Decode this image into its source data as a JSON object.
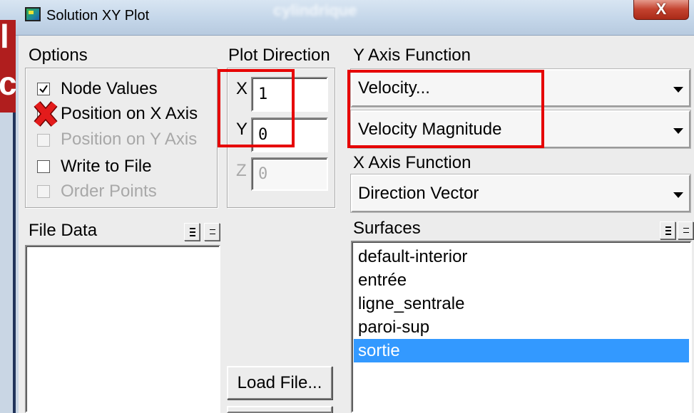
{
  "window": {
    "title": "Solution XY Plot",
    "background_window_title": "cylindrique",
    "close_label": "X",
    "app_icon": "fluent-window-icon"
  },
  "slide_fragments": {
    "top": "l",
    "bottom": "c"
  },
  "options": {
    "label": "Options",
    "items": [
      {
        "label": "Node Values",
        "checked": true,
        "enabled": true
      },
      {
        "label": "Position on X Axis",
        "checked": false,
        "enabled": true,
        "annotation": "red-cross-icon"
      },
      {
        "label": "Position on Y Axis",
        "checked": false,
        "enabled": false
      },
      {
        "label": "Write to File",
        "checked": false,
        "enabled": true
      },
      {
        "label": "Order Points",
        "checked": false,
        "enabled": false
      }
    ]
  },
  "plot_direction": {
    "label": "Plot Direction",
    "x": {
      "label": "X",
      "value": "1",
      "enabled": true
    },
    "y": {
      "label": "Y",
      "value": "0",
      "enabled": true
    },
    "z": {
      "label": "Z",
      "value": "0",
      "enabled": false
    }
  },
  "y_axis_function": {
    "label": "Y Axis Function",
    "category": "Velocity...",
    "quantity": "Velocity Magnitude"
  },
  "x_axis_function": {
    "label": "X Axis Function",
    "value": "Direction Vector"
  },
  "file_data": {
    "label": "File Data",
    "items": [],
    "buttons": [
      "select-all-icon",
      "deselect-all-icon"
    ]
  },
  "surfaces": {
    "label": "Surfaces",
    "items": [
      "default-interior",
      "entrée",
      "ligne_sentrale",
      "paroi-sup",
      "sortie"
    ],
    "selected": "sortie",
    "buttons": [
      "select-all-icon",
      "deselect-all-icon"
    ]
  },
  "buttons": {
    "load_file": "Load File..."
  },
  "colors": {
    "selection": "#3399ff",
    "annotation": "#e60000",
    "slide_background": "#b01e1e",
    "close_button": "#c4432f",
    "disabled_text": "#a8a8a8"
  }
}
